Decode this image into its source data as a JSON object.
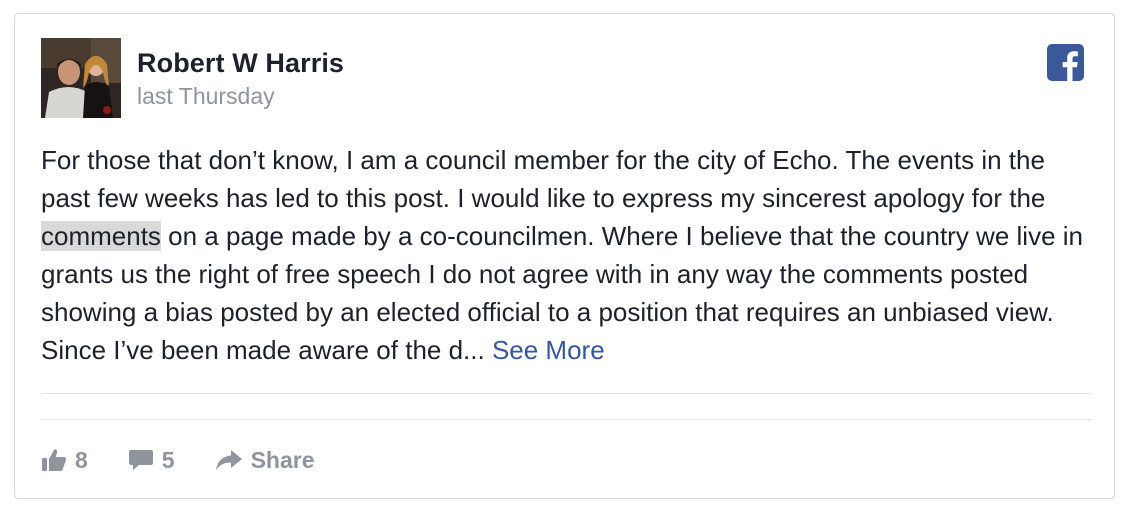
{
  "post": {
    "author": "Robert W Harris",
    "timestamp": "last Thursday",
    "text_before_highlight": "For those that don’t know, I am a council member for the city of Echo. The events in the past few weeks has led to this post. I would like to express my sincerest apology for the ",
    "highlighted_word": "comments",
    "text_after_highlight": " on a page made by a co-councilmen. Where I believe that the country we live in grants us the right of free speech I do not agree with in any way the comments posted showing a bias posted by an elected official to a position that requires an unbiased view. Since I’ve been made aware of the d... ",
    "see_more_label": "See More"
  },
  "actions": {
    "like_count": "8",
    "comment_count": "5",
    "share_label": "Share"
  },
  "icons": {
    "brand": "facebook-icon",
    "like": "thumbs-up-icon",
    "comment": "comment-bubble-icon",
    "share": "share-arrow-icon"
  },
  "colors": {
    "facebook_blue": "#3b5998",
    "link_blue": "#365899",
    "muted_gray": "#90949c",
    "text_dark": "#1d2129",
    "highlight": "#d9d9d9"
  }
}
